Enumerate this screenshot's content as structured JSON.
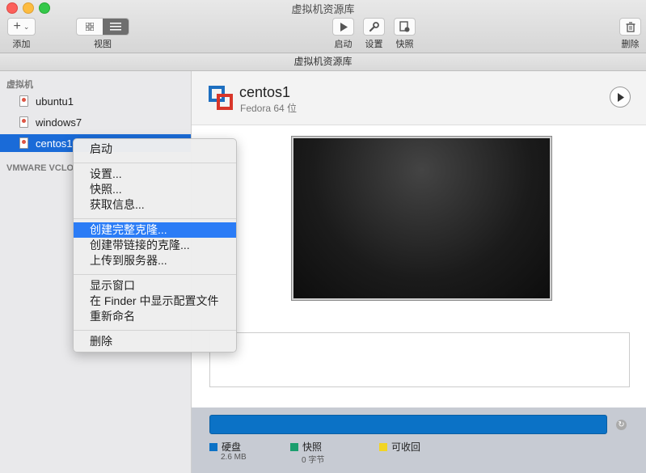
{
  "window": {
    "title": "虚拟机资源库"
  },
  "toolbar": {
    "add_label": "添加",
    "view_label": "视图",
    "start_label": "启动",
    "settings_label": "设置",
    "snapshot_label": "快照",
    "delete_label": "删除"
  },
  "subtitle": "虚拟机资源库",
  "sidebar": {
    "section_vm": "虚拟机",
    "items": [
      {
        "label": "ubuntu1"
      },
      {
        "label": "windows7"
      },
      {
        "label": "centos1"
      }
    ],
    "section_vcloud": "VMWARE VCLO"
  },
  "vm": {
    "name": "centos1",
    "os": "Fedora 64 位"
  },
  "storage": {
    "legend": [
      {
        "label": "硬盘",
        "value": "2.6 MB",
        "color": "#0b72c6"
      },
      {
        "label": "快照",
        "value": "0 字节",
        "color": "#1a9e6e"
      },
      {
        "label": "可收回",
        "value": "",
        "color": "#f2d524"
      }
    ],
    "bar_color": "#0b72c6"
  },
  "context_menu": {
    "items": [
      "启动",
      "设置...",
      "快照...",
      "获取信息...",
      "创建完整克隆...",
      "创建带链接的克隆...",
      "上传到服务器...",
      "显示窗口",
      "在 Finder 中显示配置文件",
      "重新命名",
      "删除"
    ],
    "highlighted": "创建完整克隆..."
  }
}
